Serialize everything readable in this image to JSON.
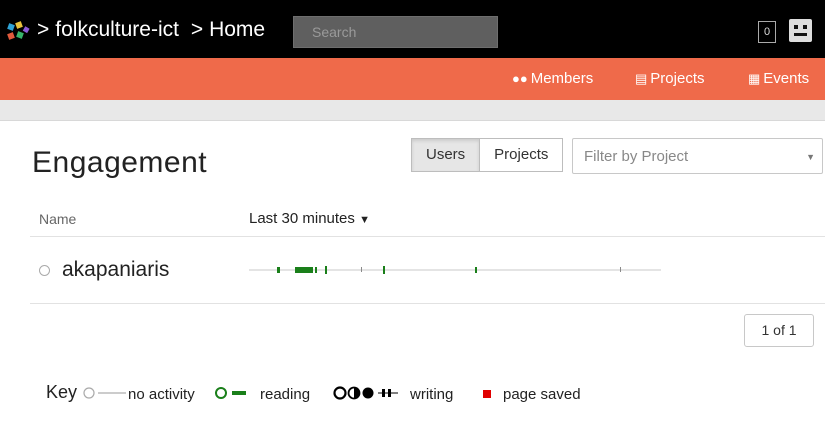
{
  "header": {
    "breadcrumb_sep1": ">",
    "org": "folkculture-ict",
    "breadcrumb_sep2": ">",
    "page": "Home",
    "search_placeholder": "Search",
    "notification_count": "0",
    "logo_icon": "grid-logo-icon",
    "avatar_icon": "user-avatar-icon"
  },
  "subnav": {
    "members": "Members",
    "projects": "Projects",
    "events": "Events",
    "members_icon": "users-icon",
    "projects_icon": "sitemap-icon",
    "events_icon": "calendar-icon"
  },
  "main": {
    "title": "Engagement",
    "toggle_users": "Users",
    "toggle_projects": "Projects",
    "filter_placeholder": "Filter by Project",
    "col_name": "Name",
    "time_range": "Last 30 minutes",
    "users": [
      {
        "name": "akapaniaris"
      }
    ],
    "pager": "1 of 1"
  },
  "key": {
    "label": "Key",
    "no_activity": "no activity",
    "reading": "reading",
    "writing": "writing",
    "page_saved": "page saved"
  },
  "colors": {
    "topbar": "#000000",
    "subnav": "#ef6a4a",
    "reading": "#1a7f1a",
    "page_saved": "#e00000"
  }
}
